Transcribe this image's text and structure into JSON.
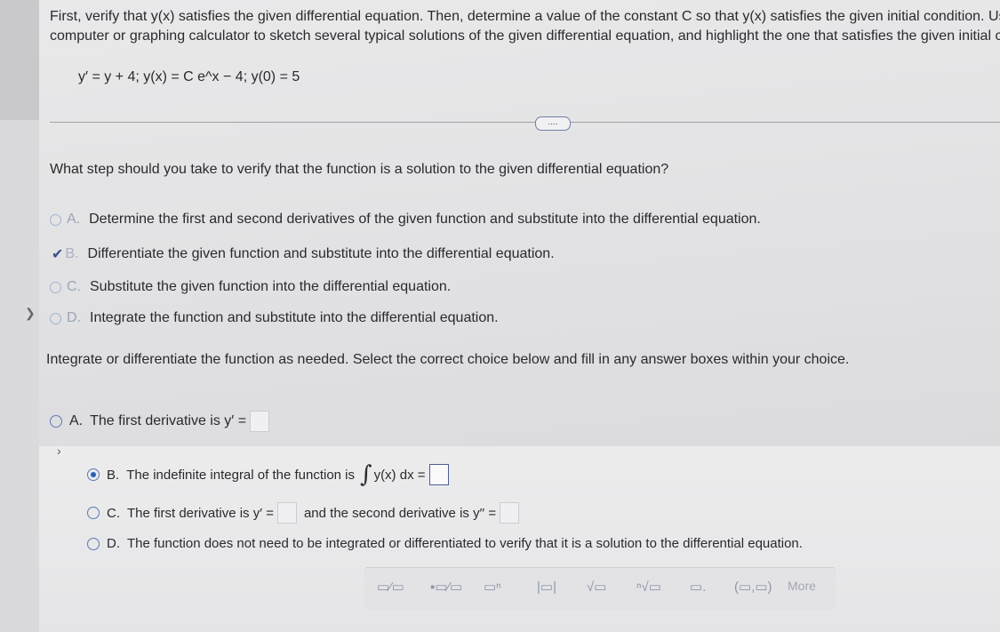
{
  "problem": {
    "intro_line1": "First, verify that y(x) satisfies the given differential equation. Then, determine a value of the constant C so that y(x) satisfies the given initial condition. Use",
    "intro_line2": "computer or graphing calculator to sketch several typical solutions of the given differential equation, and highlight the one that satisfies the given initial co",
    "equation": "y′ = y + 4;  y(x) = C e^x − 4;  y(0) = 5"
  },
  "expand_button": "....",
  "step1": {
    "question": "What step should you take to verify that the function is a solution to the given differential equation?",
    "options": [
      {
        "letter": "A.",
        "text": "Determine the first and second derivatives of the given function and substitute into the differential equation."
      },
      {
        "letter": "B.",
        "text": "Differentiate the given function and substitute into the differential equation.",
        "mark": "✔"
      },
      {
        "letter": "C.",
        "text": "Substitute the given function into the differential equation."
      },
      {
        "letter": "D.",
        "text": "Integrate the function and substitute into the differential equation."
      }
    ]
  },
  "step2": {
    "instruction": "Integrate or differentiate the function as needed. Select the correct choice below and fill in any answer boxes within your choice.",
    "options": [
      {
        "letter": "A.",
        "text": "The first derivative is y′ ="
      },
      {
        "letter": "B.",
        "text": "The indefinite integral of the function is",
        "integral_symbol": "∫",
        "integral_expr": "y(x) dx ="
      },
      {
        "letter": "C.",
        "text": "The first derivative is y′ =",
        "text2": "and the second derivative is y′′ ="
      },
      {
        "letter": "D.",
        "text": "The function does not need to be integrated or differentiated to verify that it is a solution to the differential equation."
      }
    ]
  },
  "toolbar": {
    "fraction": "▭⁄▭",
    "mixed": "▪▭⁄▭",
    "exponent": "▭ⁿ",
    "abs": "|▭|",
    "sqrt": "√▭",
    "nthroot": "ⁿ√▭",
    "decimal": "▭.",
    "interval": "(▭,▭)",
    "more": "More"
  }
}
